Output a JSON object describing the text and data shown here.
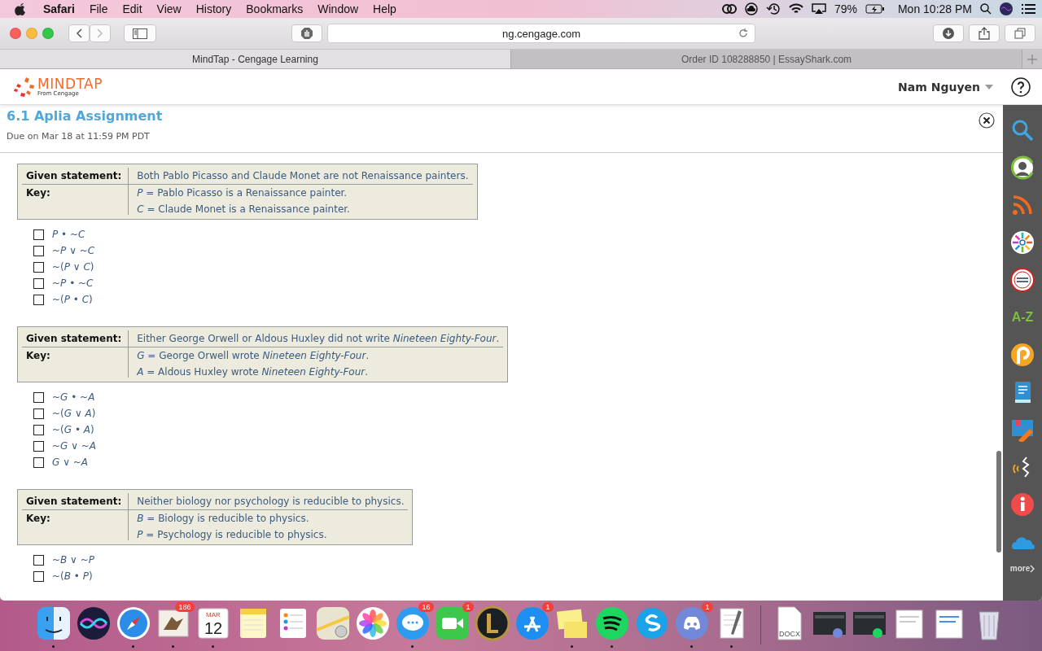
{
  "menubar": {
    "app": "Safari",
    "menus": [
      "File",
      "Edit",
      "View",
      "History",
      "Bookmarks",
      "Window",
      "Help"
    ],
    "battery": "79%",
    "clock": "Mon 10:28 PM"
  },
  "toolbar": {
    "url": "ng.cengage.com"
  },
  "tabs": [
    {
      "label": "MindTap - Cengage Learning",
      "selected": true
    },
    {
      "label": "Order ID 108288850 | EssayShark.com",
      "selected": false
    }
  ],
  "header": {
    "logo": "MINDTAP",
    "logo_sub": "From Cengage",
    "user": "Nam Nguyen"
  },
  "assignment": {
    "title": "6.1 Aplia Assignment",
    "due": "Due on Mar 18 at 11:59 PM PDT"
  },
  "problems": [
    {
      "statement_label": "Given statement:",
      "statement": "Both Pablo Picasso and Claude Monet are not Renaissance painters.",
      "key_label": "Key:",
      "keys": [
        "*P* = Pablo Picasso is a Renaissance painter.",
        "*C* = Claude Monet is a Renaissance painter."
      ],
      "options": [
        {
          "text": "*P* • ~*C*",
          "checked": false
        },
        {
          "text": "~*P* ∨ ~*C*",
          "checked": false
        },
        {
          "text": "~(*P* ∨ *C*)",
          "checked": false
        },
        {
          "text": "~*P* • ~*C*",
          "checked": false
        },
        {
          "text": "~(*P* • *C*)",
          "checked": false
        }
      ]
    },
    {
      "statement_label": "Given statement:",
      "statement": "Either George Orwell or Aldous Huxley did not write *Nineteen Eighty-Four*.",
      "key_label": "Key:",
      "keys": [
        "*G* = George Orwell wrote *Nineteen Eighty-Four*.",
        "*A* = Aldous Huxley wrote *Nineteen Eighty-Four*."
      ],
      "options": [
        {
          "text": "~*G* • ~*A*",
          "checked": false
        },
        {
          "text": "~(*G* ∨ *A*)",
          "checked": false
        },
        {
          "text": "~(*G* • *A*)",
          "checked": false
        },
        {
          "text": "~*G* ∨ ~*A*",
          "checked": false
        },
        {
          "text": "*G* ∨ ~*A*",
          "checked": false
        }
      ]
    },
    {
      "statement_label": "Given statement:",
      "statement": "Neither biology nor psychology is reducible to physics.",
      "key_label": "Key:",
      "keys": [
        "*B* = Biology is reducible to physics.",
        "*P* = Psychology is reducible to physics."
      ],
      "options": [
        {
          "text": "~*B* ∨ ~*P*",
          "checked": false
        },
        {
          "text": "~(*B* • *P*)",
          "checked": false
        }
      ]
    }
  ],
  "tools": [
    {
      "kind": "search"
    },
    {
      "kind": "profile"
    },
    {
      "kind": "rss"
    },
    {
      "kind": "wheel"
    },
    {
      "kind": "dictionary"
    },
    {
      "kind": "glossary",
      "label": "A-Z"
    },
    {
      "kind": "coin"
    },
    {
      "kind": "book"
    },
    {
      "kind": "crayon"
    },
    {
      "kind": "audio"
    },
    {
      "kind": "info"
    },
    {
      "kind": "cloud"
    },
    {
      "kind": "more",
      "label": "more"
    }
  ],
  "dock": [
    {
      "kind": "finder",
      "running": true
    },
    {
      "kind": "siri",
      "running": false
    },
    {
      "kind": "safari",
      "running": true
    },
    {
      "kind": "mail",
      "badge": "186",
      "running": true
    },
    {
      "kind": "calendar",
      "month": "MAR",
      "day": "12",
      "running": true
    },
    {
      "kind": "notes",
      "running": false
    },
    {
      "kind": "reminders",
      "running": false
    },
    {
      "kind": "maps",
      "running": false
    },
    {
      "kind": "photos",
      "running": false
    },
    {
      "kind": "messages",
      "badge": "16",
      "running": true
    },
    {
      "kind": "facetime",
      "badge": "1",
      "running": false
    },
    {
      "kind": "game",
      "running": false
    },
    {
      "kind": "appstore",
      "badge": "1",
      "running": false
    },
    {
      "kind": "stickies",
      "running": true
    },
    {
      "kind": "spotify",
      "running": true
    },
    {
      "kind": "skype",
      "running": false
    },
    {
      "kind": "discord",
      "badge": "1",
      "running": true
    },
    {
      "kind": "textedit",
      "running": true
    },
    {
      "kind": "separator"
    },
    {
      "kind": "document",
      "label": "DOCX"
    },
    {
      "kind": "window"
    },
    {
      "kind": "window2"
    },
    {
      "kind": "page"
    },
    {
      "kind": "page2"
    },
    {
      "kind": "trash"
    }
  ]
}
